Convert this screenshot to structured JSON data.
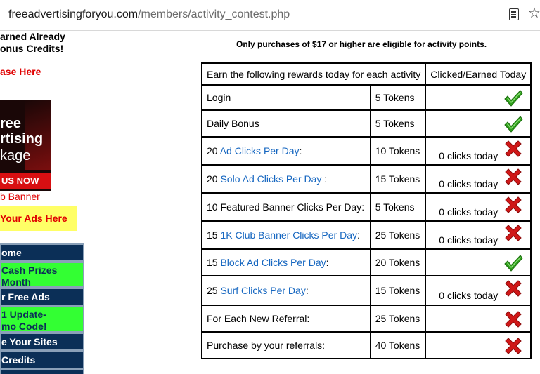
{
  "browser": {
    "url_domain": "freeadvertisingforyou.com",
    "url_path": "/members/activity_contest.php",
    "reader_icon": "reader-view-icon",
    "bookmark_icon": "bookmark-star-icon"
  },
  "sidebar": {
    "earned_line1": "arned Already",
    "earned_line2": "onus Credits!",
    "purchase_link": "ase Here",
    "banner": {
      "line1": "ree",
      "line2": "rtising",
      "line3": "kage",
      "line4": "US NOW"
    },
    "club_banner_link": "b Banner",
    "your_ads_link": "Your Ads Here",
    "nav_items": [
      {
        "label": "ome",
        "style": "dark"
      },
      {
        "label": "Cash Prizes",
        "label2": "Month",
        "style": "green"
      },
      {
        "label": "r Free Ads",
        "style": "dark"
      },
      {
        "label": "1 Update-",
        "label2": "mo Code!",
        "style": "green"
      },
      {
        "label": "e Your Sites",
        "style": "dark"
      },
      {
        "label": "Credits",
        "style": "dark"
      }
    ]
  },
  "main": {
    "notice": "Only purchases of $17 or higher are eligible for activity points.",
    "table": {
      "headers": [
        "Earn the following rewards today for each activity",
        "Clicked/Earned Today"
      ],
      "rows": [
        {
          "prefix": "Login",
          "link": "",
          "suffix": "",
          "reward": "5 Tokens",
          "clicks": "",
          "status": "earned"
        },
        {
          "prefix": "Daily Bonus",
          "link": "",
          "suffix": "",
          "reward": "5 Tokens",
          "clicks": "",
          "status": "earned"
        },
        {
          "prefix": "20 ",
          "link": "Ad Clicks Per Day",
          "suffix": ":",
          "reward": "10 Tokens",
          "clicks": "0 clicks today",
          "status": "not_earned"
        },
        {
          "prefix": "20 ",
          "link": "Solo Ad Clicks Per Day",
          "suffix": " :",
          "reward": "15 Tokens",
          "clicks": "0 clicks today",
          "status": "not_earned"
        },
        {
          "prefix": "10 Featured Banner Clicks Per Day:",
          "link": "",
          "suffix": "",
          "reward": "5 Tokens",
          "clicks": "0 clicks today",
          "status": "not_earned"
        },
        {
          "prefix": "15 ",
          "link": "1K Club Banner Clicks Per Day",
          "suffix": ":",
          "reward": "25 Tokens",
          "clicks": "0 clicks today",
          "status": "not_earned"
        },
        {
          "prefix": "15 ",
          "link": "Block Ad Clicks Per Day",
          "suffix": ":",
          "reward": "20 Tokens",
          "clicks": "",
          "status": "earned"
        },
        {
          "prefix": "25 ",
          "link": "Surf Clicks Per Day",
          "suffix": ":",
          "reward": "15 Tokens",
          "clicks": "0 clicks today",
          "status": "not_earned"
        },
        {
          "prefix": "For Each New Referral:",
          "link": "",
          "suffix": "",
          "reward": "25 Tokens",
          "clicks": "",
          "status": "not_earned"
        },
        {
          "prefix": "Purchase by your referrals:",
          "link": "",
          "suffix": "",
          "reward": "40 Tokens",
          "clicks": "",
          "status": "not_earned"
        }
      ]
    }
  },
  "colors": {
    "link_blue": "#1566c0",
    "alert_red": "#e00000",
    "nav_dark": "#0b2f57",
    "nav_green": "#33ff33",
    "check_green": "#2e9e1a",
    "cross_red": "#d01818"
  }
}
